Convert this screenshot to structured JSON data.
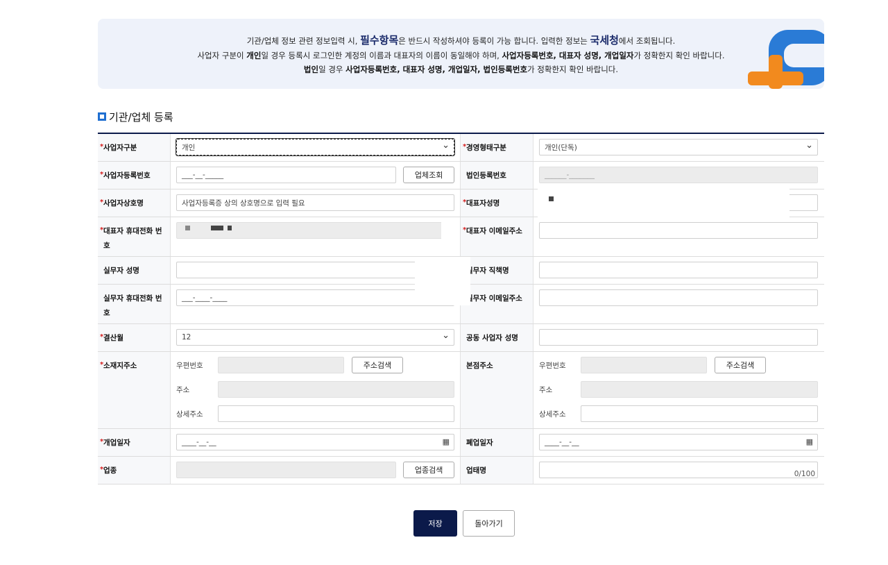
{
  "notice": {
    "line1_a": "기관/업체 정보 관련 정보입력 시,",
    "line1_big": "필수항목",
    "line1_b": "은 반드시 작성하셔야 등록이 가능 합니다. 입력한 정보는",
    "line1_big2": "국세청",
    "line1_c": "에서 조회됩니다.",
    "line2_a": "사업자 구분이",
    "line2_b1": "개인",
    "line2_c": "일 경우 등록시 로그인한 계정의 이름과 대표자의 이름이 동일해야 하며,",
    "line2_b2": "사업자등록번호, 대표자 성명, 개업일자",
    "line2_d": "가 정확한지 확인 바랍니다.",
    "line3_b1": "법인",
    "line3_a": "일 경우",
    "line3_b2": "사업자등록번호, 대표자 성명, 개업일자, 법인등록번호",
    "line3_c": "가 정확한지 확인 바랍니다."
  },
  "section_title": "기관/업체 등록",
  "form": {
    "business_type_label": "사업자구분",
    "business_type_value": "개인",
    "mgmt_type_label": "경영형태구분",
    "mgmt_type_value": "개인(단독)",
    "biz_reg_no_label": "사업자등록번호",
    "biz_reg_no_placeholder": "___-__-_____",
    "company_lookup_button": "업체조회",
    "corp_reg_no_label": "법인등록번호",
    "corp_reg_no_placeholder": "______-_______",
    "biz_name_label": "사업자상호명",
    "biz_name_placeholder": "사업자등록증 상의 상호명으로 입력 필요",
    "rep_name_label": "대표자성명",
    "rep_phone_label": "대표자 휴대전화 번호",
    "rep_email_label": "대표자 이메일주소",
    "staff_name_label": "실무자 성명",
    "staff_title_label": "실무자 직책명",
    "staff_phone_label": "실무자 휴대전화 번호",
    "staff_phone_placeholder": "___-____-____",
    "staff_email_label": "실무자 이메일주소",
    "fiscal_month_label": "결산월",
    "fiscal_month_value": "12",
    "co_owner_label": "공동 사업자 성명",
    "location_label": "소재지주소",
    "hq_label": "본점주소",
    "zip_label": "우편번호",
    "addr_label": "주소",
    "addr_detail_label": "상세주소",
    "addr_search_button": "주소검색",
    "open_date_label": "개업일자",
    "close_date_label": "폐업일자",
    "date_placeholder": "____-__-__",
    "industry_label": "업종",
    "industry_search_button": "업종검색",
    "business_kind_label": "업태명",
    "business_kind_counter": "0/100"
  },
  "buttons": {
    "save": "저장",
    "back": "돌아가기"
  },
  "colors": {
    "navy": "#0b1a4a",
    "accent_blue": "#1f6fd1",
    "required": "#d41c1c",
    "logo_orange": "#f28a1e",
    "logo_blue": "#2a7bd6"
  }
}
